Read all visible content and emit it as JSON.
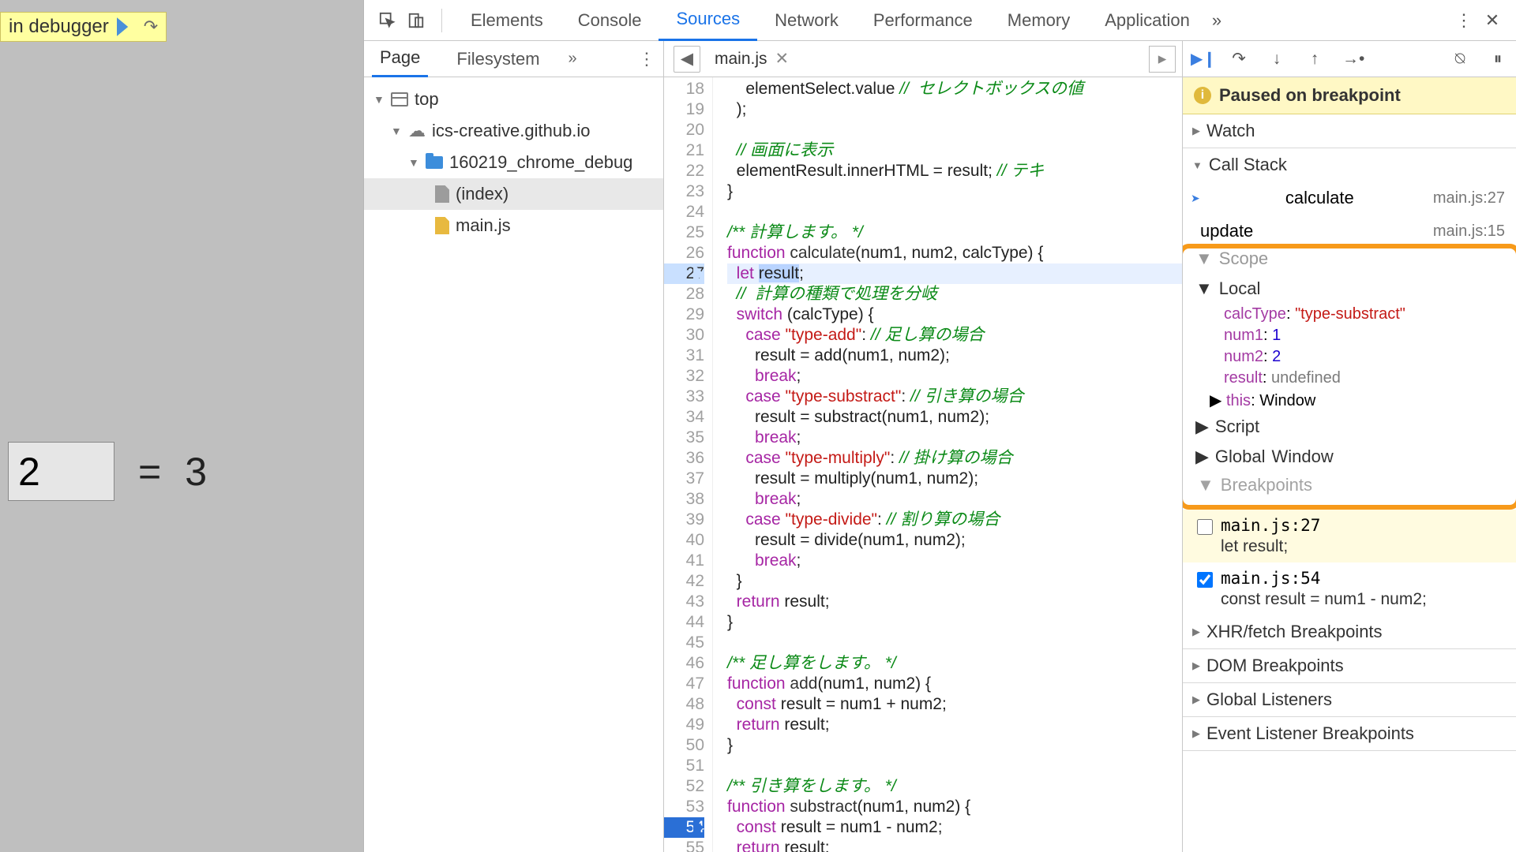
{
  "page": {
    "debugger_badge": "in debugger",
    "input_value": "2",
    "equals": "=",
    "result": "3"
  },
  "tabs": {
    "elements": "Elements",
    "console": "Console",
    "sources": "Sources",
    "network": "Network",
    "performance": "Performance",
    "memory": "Memory",
    "application": "Application"
  },
  "nav": {
    "page": "Page",
    "filesystem": "Filesystem",
    "tree": {
      "top": "top",
      "domain": "ics-creative.github.io",
      "folder": "160219_chrome_debug",
      "index": "(index)",
      "script": "main.js"
    }
  },
  "editor": {
    "filename": "main.js",
    "lines": [
      {
        "n": 18,
        "html": "    elementSelect.value <span class='c-cmt'>//  セレクトボックスの値</span>"
      },
      {
        "n": 19,
        "html": "  );"
      },
      {
        "n": 20,
        "html": ""
      },
      {
        "n": 21,
        "html": "  <span class='c-cmt'>// 画面に表示</span>"
      },
      {
        "n": 22,
        "html": "  elementResult.innerHTML = result; <span class='c-cmt'>// テキ</span>"
      },
      {
        "n": 23,
        "html": "}"
      },
      {
        "n": 24,
        "html": ""
      },
      {
        "n": 25,
        "html": "<span class='c-cmt'>/** 計算します。 */</span>"
      },
      {
        "n": 26,
        "html": "<span class='c-kw'>function</span> <span class='c-fn'>calculate</span>(num1, num2, calcType) {"
      },
      {
        "n": 27,
        "html": "  <span class='c-kw'>let</span> <span class='sel'>result</span>;",
        "cur": true,
        "hl": true
      },
      {
        "n": 28,
        "html": "  <span class='c-cmt'>//  計算の種類で処理を分岐</span>"
      },
      {
        "n": 29,
        "html": "  <span class='c-kw'>switch</span> (calcType) {"
      },
      {
        "n": 30,
        "html": "    <span class='c-kw'>case</span> <span class='c-str'>\"type-add\"</span>: <span class='c-cmt'>// 足し算の場合</span>"
      },
      {
        "n": 31,
        "html": "      result = add(num1, num2);"
      },
      {
        "n": 32,
        "html": "      <span class='c-kw'>break</span>;"
      },
      {
        "n": 33,
        "html": "    <span class='c-kw'>case</span> <span class='c-str'>\"type-substract\"</span>: <span class='c-cmt'>// 引き算の場合</span>"
      },
      {
        "n": 34,
        "html": "      result = substract(num1, num2);"
      },
      {
        "n": 35,
        "html": "      <span class='c-kw'>break</span>;"
      },
      {
        "n": 36,
        "html": "    <span class='c-kw'>case</span> <span class='c-str'>\"type-multiply\"</span>: <span class='c-cmt'>// 掛け算の場合</span>"
      },
      {
        "n": 37,
        "html": "      result = multiply(num1, num2);"
      },
      {
        "n": 38,
        "html": "      <span class='c-kw'>break</span>;"
      },
      {
        "n": 39,
        "html": "    <span class='c-kw'>case</span> <span class='c-str'>\"type-divide\"</span>: <span class='c-cmt'>// 割り算の場合</span>"
      },
      {
        "n": 40,
        "html": "      result = divide(num1, num2);"
      },
      {
        "n": 41,
        "html": "      <span class='c-kw'>break</span>;"
      },
      {
        "n": 42,
        "html": "  }"
      },
      {
        "n": 43,
        "html": "  <span class='c-kw'>return</span> result;"
      },
      {
        "n": 44,
        "html": "}"
      },
      {
        "n": 45,
        "html": ""
      },
      {
        "n": 46,
        "html": "<span class='c-cmt'>/** 足し算をします。 */</span>"
      },
      {
        "n": 47,
        "html": "<span class='c-kw'>function</span> <span class='c-fn'>add</span>(num1, num2) {"
      },
      {
        "n": 48,
        "html": "  <span class='c-kw'>const</span> result = num1 + num2;"
      },
      {
        "n": 49,
        "html": "  <span class='c-kw'>return</span> result;"
      },
      {
        "n": 50,
        "html": "}"
      },
      {
        "n": 51,
        "html": ""
      },
      {
        "n": 52,
        "html": "<span class='c-cmt'>/** 引き算をします。 */</span>"
      },
      {
        "n": 53,
        "html": "<span class='c-kw'>function</span> <span class='c-fn'>substract</span>(num1, num2) {"
      },
      {
        "n": 54,
        "html": "  <span class='c-kw'>const</span> result = num1 - num2;",
        "bp": true
      },
      {
        "n": 55,
        "html": "  <span class='c-kw'>return</span> result;"
      }
    ]
  },
  "debug": {
    "paused": "Paused on breakpoint",
    "watch": "Watch",
    "callstack": "Call Stack",
    "stack": [
      {
        "fn": "calculate",
        "loc": "main.js:27",
        "cur": true
      },
      {
        "fn": "update",
        "loc": "main.js:15"
      }
    ],
    "scope_label": "Scope",
    "local": "Local",
    "vars": {
      "calcType": {
        "k": "calcType",
        "v": "\"type-substract\"",
        "cls": "k-str"
      },
      "num1": {
        "k": "num1",
        "v": "1",
        "cls": "k-num"
      },
      "num2": {
        "k": "num2",
        "v": "2",
        "cls": "k-num"
      },
      "result": {
        "k": "result",
        "v": "undefined",
        "cls": "k-undef"
      },
      "this": {
        "k": "this",
        "v": "Window",
        "cls": ""
      }
    },
    "script": "Script",
    "global": "Global",
    "global_v": "Window",
    "breakpoints_label": "Breakpoints",
    "bp": [
      {
        "checked": false,
        "file": "main.js:27",
        "code": "let result;",
        "y": true
      },
      {
        "checked": true,
        "file": "main.js:54",
        "code": "const result = num1 - num2;"
      }
    ],
    "sections": {
      "xhr": "XHR/fetch Breakpoints",
      "dom": "DOM Breakpoints",
      "gl": "Global Listeners",
      "ev": "Event Listener Breakpoints"
    }
  }
}
